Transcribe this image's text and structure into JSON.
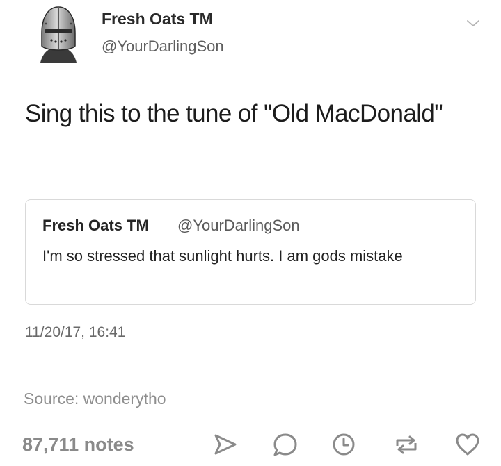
{
  "tweet": {
    "display_name": "Fresh Oats TM",
    "handle": "@YourDarlingSon",
    "text": "Sing this to the tune of \"Old MacDonald\"",
    "timestamp": "11/20/17, 16:41"
  },
  "quoted_tweet": {
    "display_name": "Fresh Oats TM",
    "handle": "@YourDarlingSon",
    "text": "I'm so stressed that sunlight hurts. I am gods mistake"
  },
  "post_footer": {
    "source": "Source: wonderytho",
    "notes": "87,711 notes",
    "actions": [
      "share-icon",
      "reply-icon",
      "history-icon",
      "reblog-icon",
      "like-icon"
    ]
  },
  "colors": {
    "icon_gray": "#8a8a8a",
    "text_dark": "#1c1c1c",
    "border": "#d9d9d9"
  }
}
